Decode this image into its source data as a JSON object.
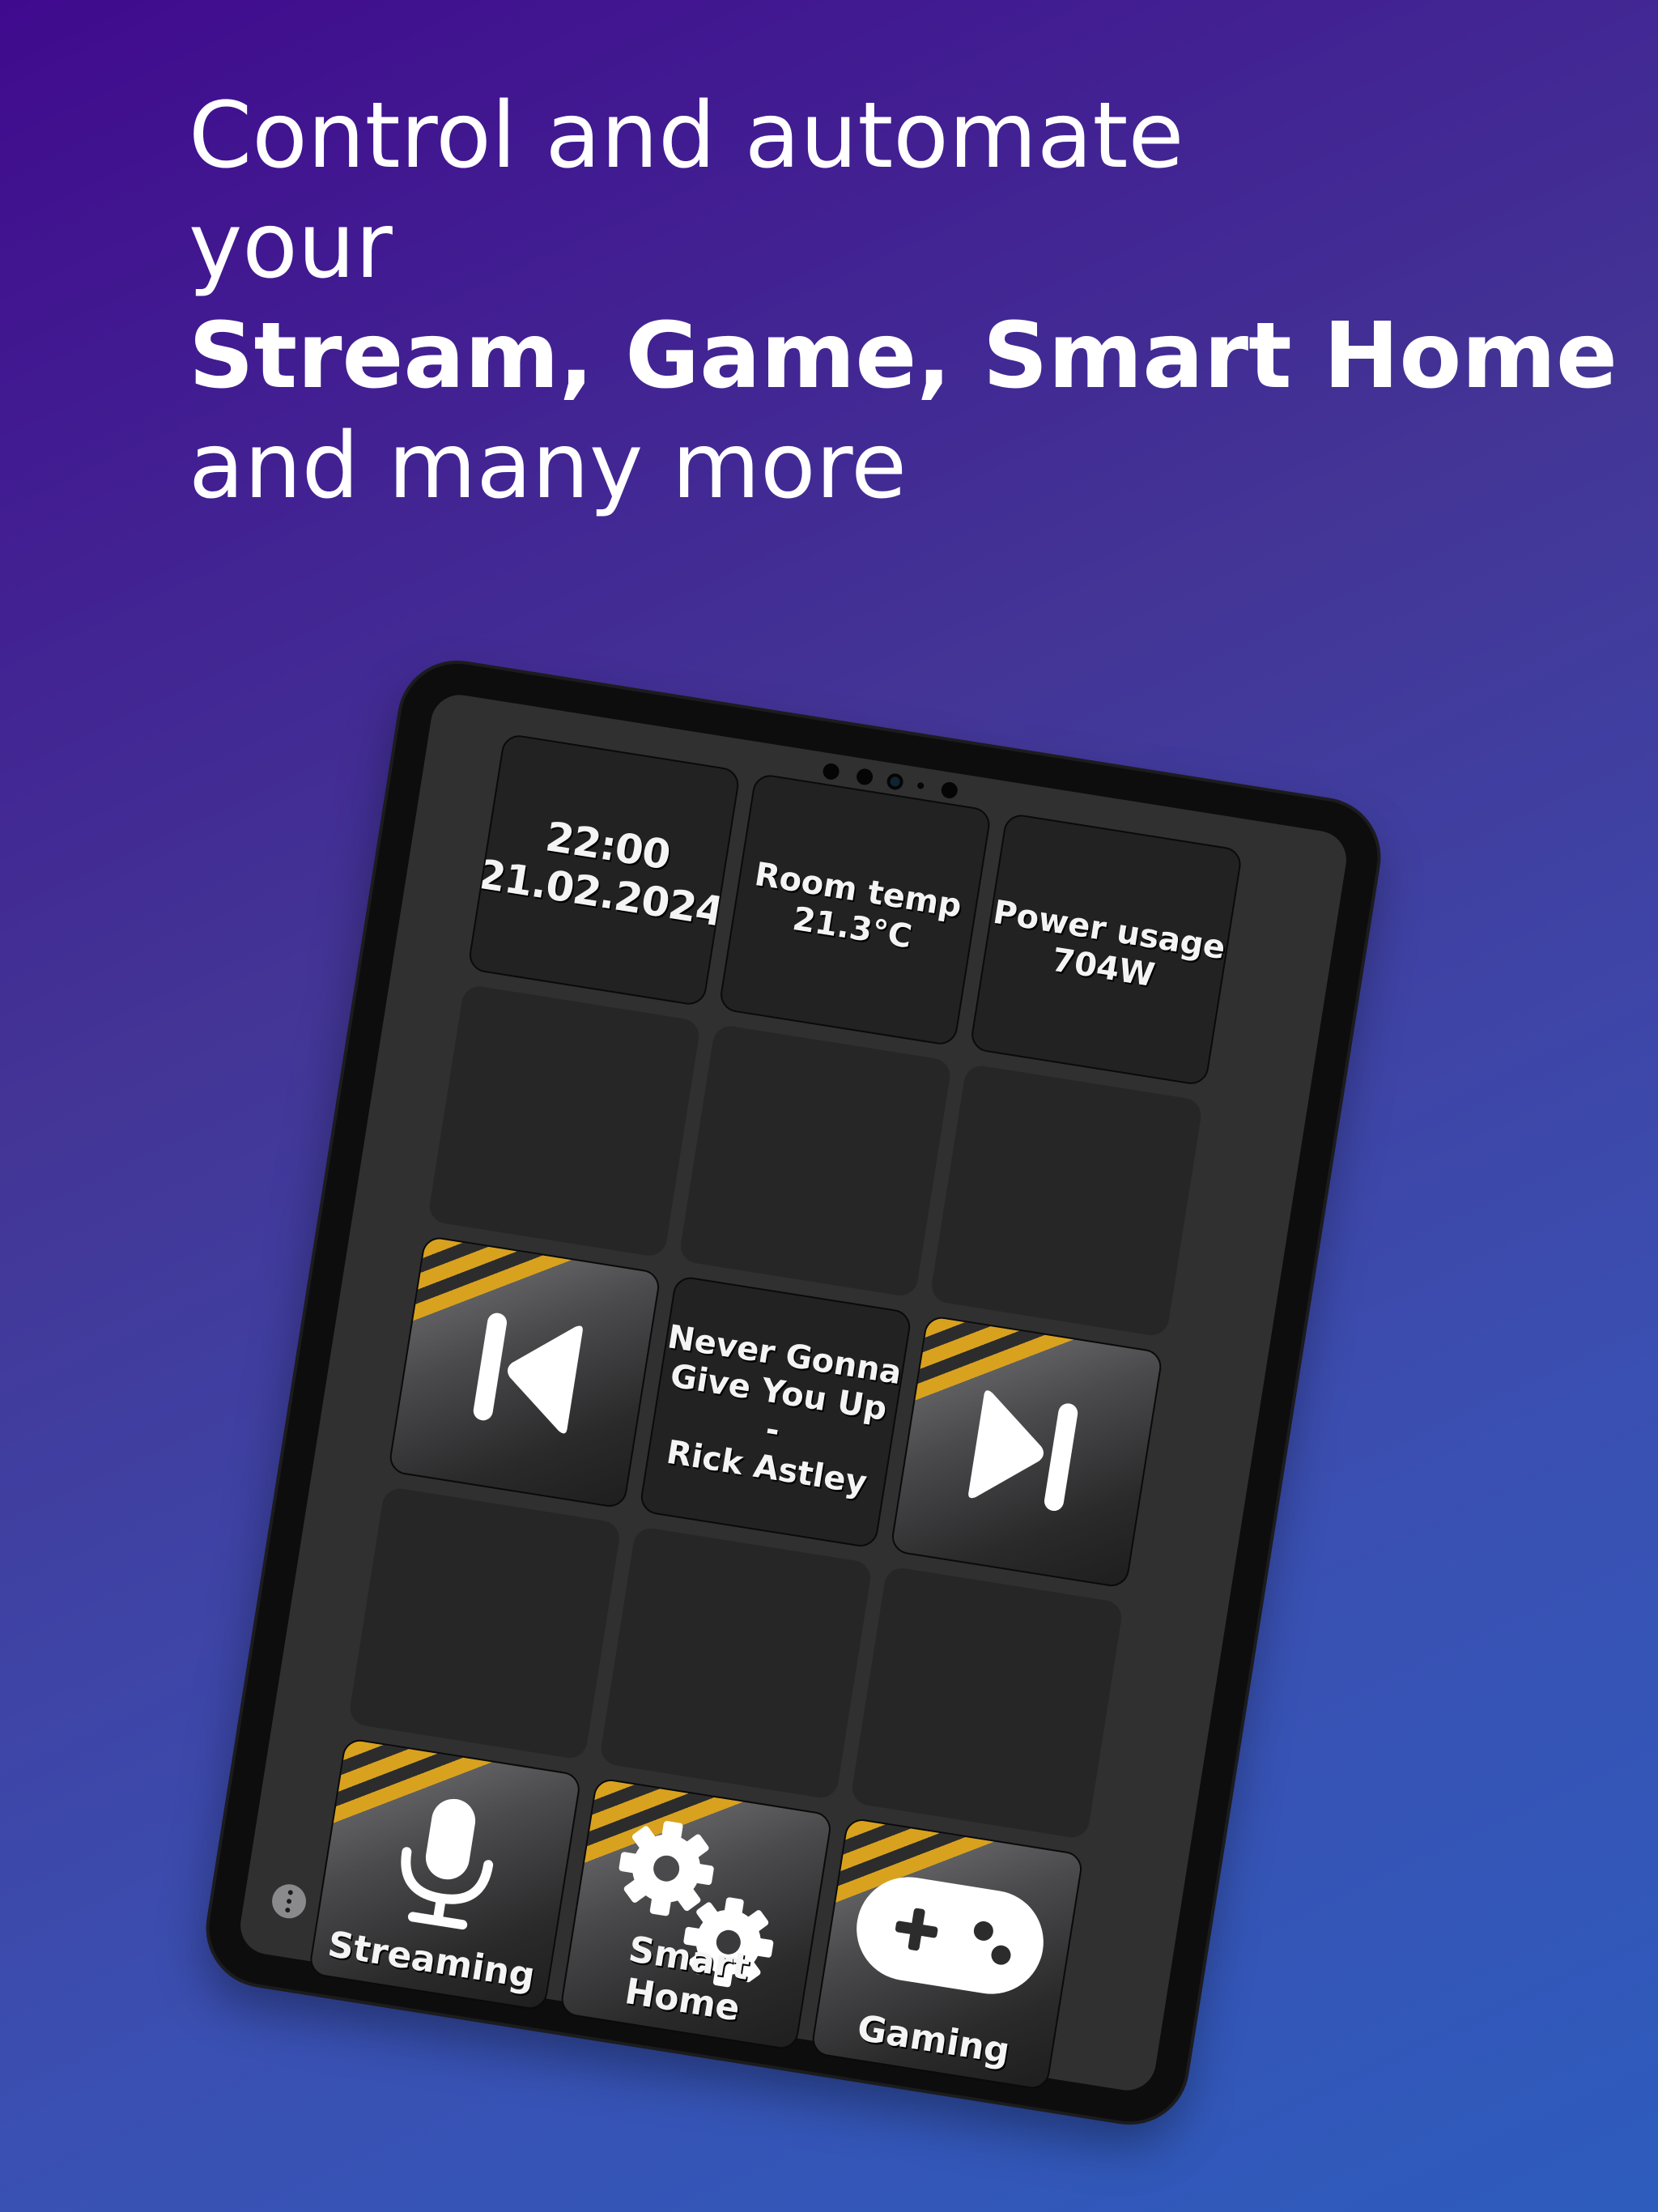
{
  "headline": {
    "line1": "Control and automate",
    "line2": "your",
    "line3": "Stream, Game, Smart Home",
    "line4": "and many more"
  },
  "deck": {
    "clock": {
      "time": "22:00",
      "date": "21.02.2024"
    },
    "room_temp": {
      "label": "Room temp",
      "value": "21.3°C"
    },
    "power": {
      "label": "Power usage",
      "value": "704W"
    },
    "now_playing": {
      "title_line1": "Never Gonna",
      "title_line2": "Give You Up",
      "separator": "-",
      "artist": "Rick Astley"
    },
    "prev_button": {
      "icon": "skip-previous-icon"
    },
    "next_button": {
      "icon": "skip-next-icon"
    },
    "folders": [
      {
        "label": "Streaming",
        "icon": "microphone-icon"
      },
      {
        "label": "Smart Home",
        "icon": "gears-icon"
      },
      {
        "label": "Gaming",
        "icon": "gamepad-icon"
      }
    ],
    "accent_colors": {
      "stripe": "#d9a21e",
      "tile": "#222223",
      "screen": "#303031"
    }
  }
}
